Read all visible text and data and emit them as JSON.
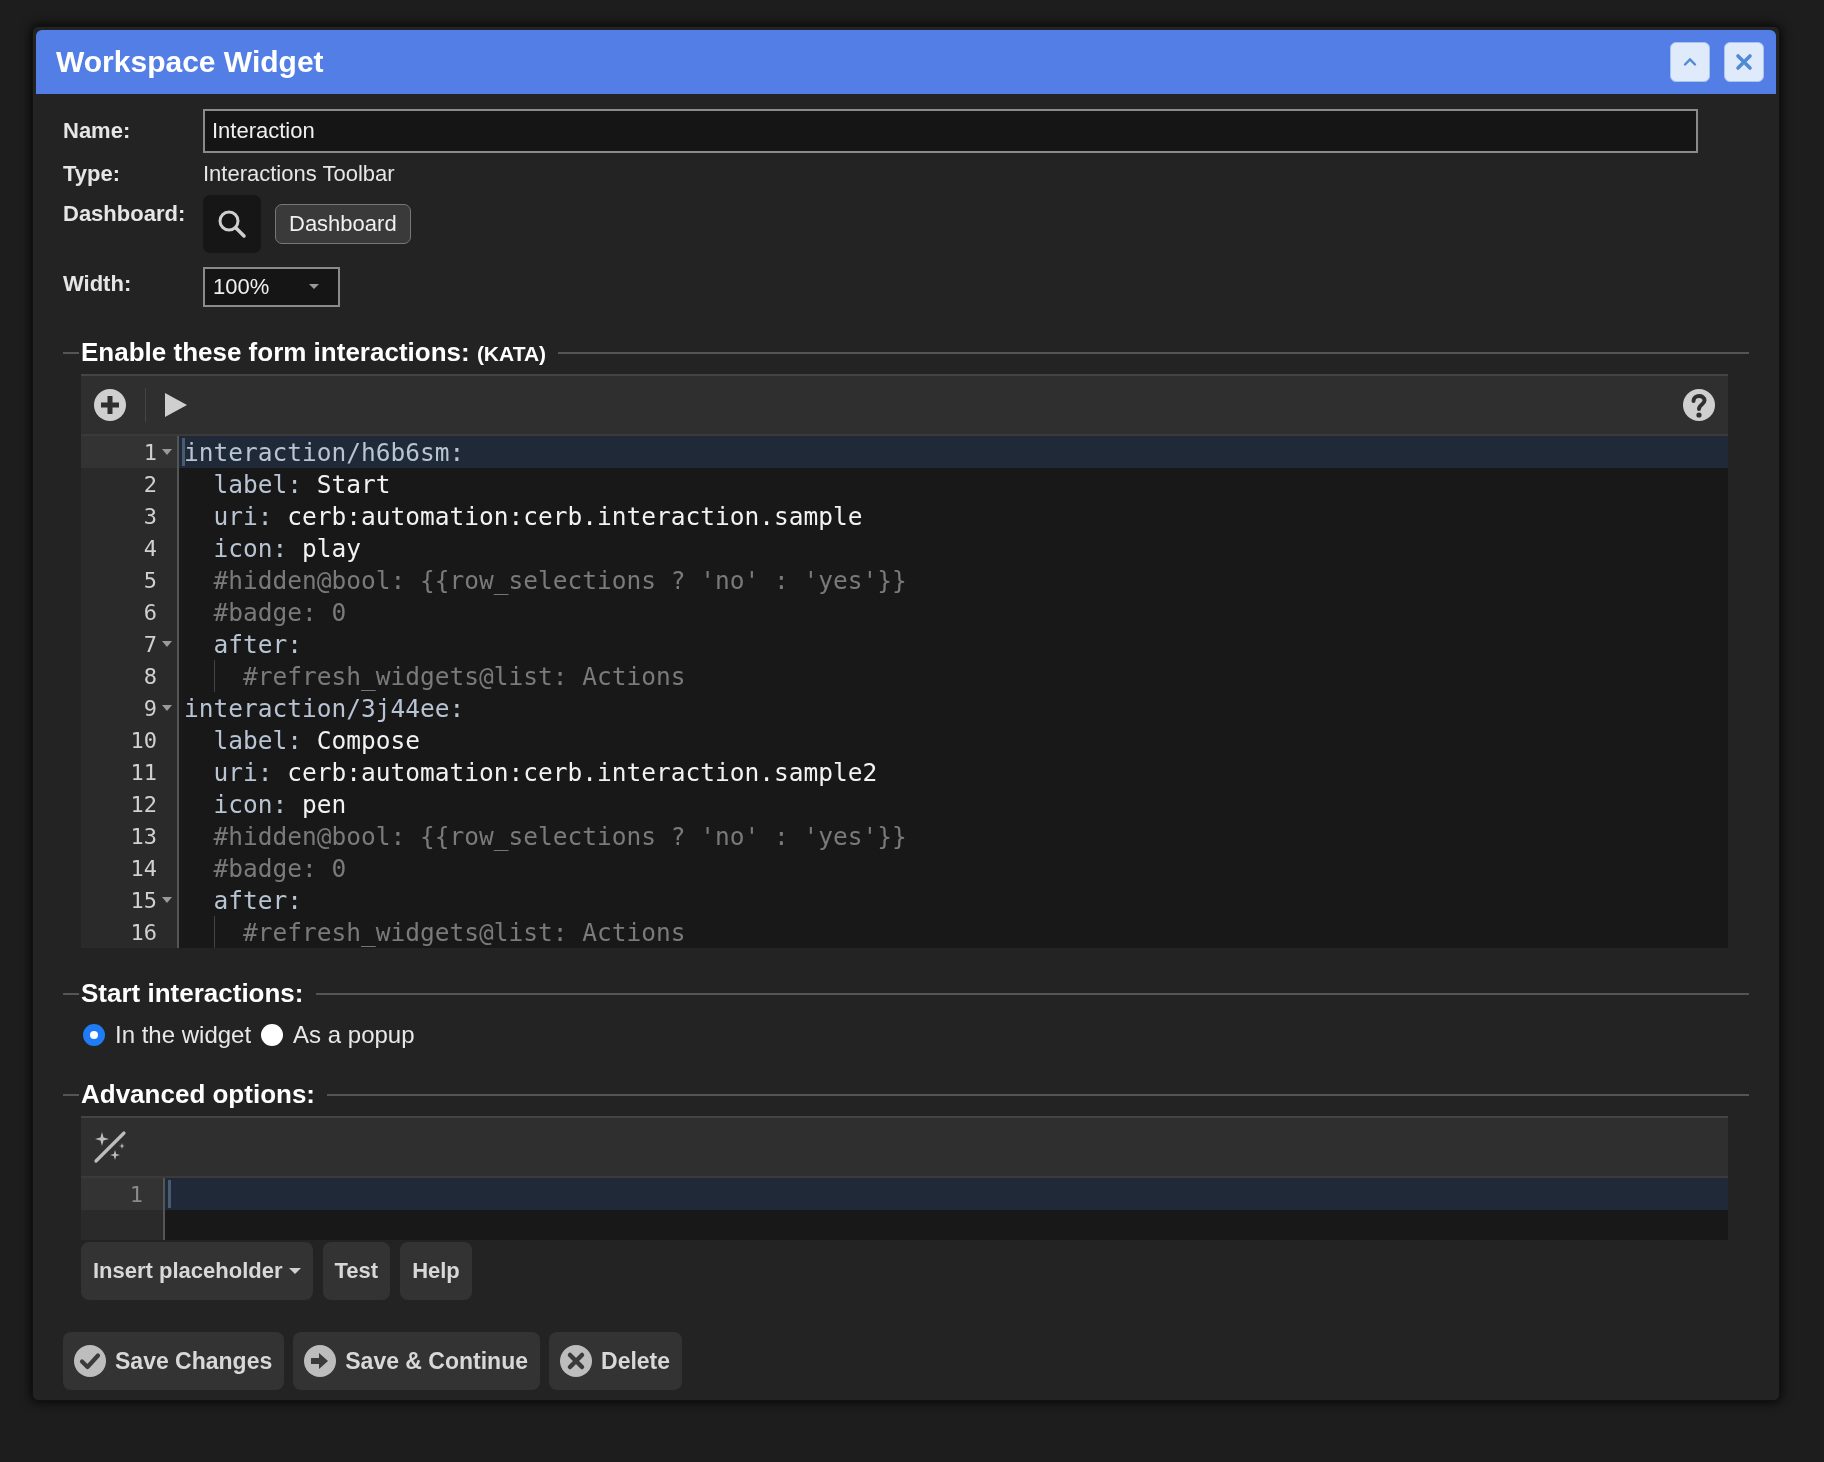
{
  "window": {
    "title": "Workspace Widget"
  },
  "form": {
    "name": {
      "label": "Name:",
      "value": "Interaction"
    },
    "type": {
      "label": "Type:",
      "value": "Interactions Toolbar"
    },
    "dashboard": {
      "label": "Dashboard:",
      "chip": "Dashboard"
    },
    "width": {
      "label": "Width:",
      "value": "100%"
    }
  },
  "interactions_section": {
    "legend": "Enable these form interactions:",
    "legend_note": "(KATA)",
    "editor": {
      "lines": [
        {
          "number": "1",
          "kind": "block",
          "fold": true,
          "active": true,
          "tokens": [
            {
              "kind": "key",
              "text": "interaction/h6b6sm:"
            }
          ]
        },
        {
          "number": "2",
          "kind": "property",
          "fold": false,
          "active": false,
          "tokens": [
            {
              "kind": "key",
              "text": "label:"
            },
            {
              "kind": "value",
              "text": "Start"
            }
          ]
        },
        {
          "number": "3",
          "kind": "property",
          "fold": false,
          "active": false,
          "tokens": [
            {
              "kind": "key",
              "text": "uri:"
            },
            {
              "kind": "value",
              "text": "cerb:automation:cerb.interaction.sample"
            }
          ]
        },
        {
          "number": "4",
          "kind": "property",
          "fold": false,
          "active": false,
          "tokens": [
            {
              "kind": "key",
              "text": "icon:"
            },
            {
              "kind": "value",
              "text": "play"
            }
          ]
        },
        {
          "number": "5",
          "kind": "property",
          "fold": false,
          "active": false,
          "tokens": [
            {
              "kind": "comment",
              "text": "#hidden@bool: {{row_selections ? 'no' : 'yes'}}"
            }
          ]
        },
        {
          "number": "6",
          "kind": "property",
          "fold": false,
          "active": false,
          "tokens": [
            {
              "kind": "comment",
              "text": "#badge: 0"
            }
          ]
        },
        {
          "number": "7",
          "kind": "property",
          "fold": true,
          "active": false,
          "tokens": [
            {
              "kind": "key",
              "text": "after:"
            }
          ]
        },
        {
          "number": "8",
          "kind": "nested",
          "fold": false,
          "active": false,
          "tokens": [
            {
              "kind": "comment",
              "text": "#refresh_widgets@list: Actions"
            }
          ]
        },
        {
          "number": "9",
          "kind": "block",
          "fold": true,
          "active": false,
          "tokens": [
            {
              "kind": "key",
              "text": "interaction/3j44ee:"
            }
          ]
        },
        {
          "number": "10",
          "kind": "property",
          "fold": false,
          "active": false,
          "tokens": [
            {
              "kind": "key",
              "text": "label:"
            },
            {
              "kind": "value",
              "text": "Compose"
            }
          ]
        },
        {
          "number": "11",
          "kind": "property",
          "fold": false,
          "active": false,
          "tokens": [
            {
              "kind": "key",
              "text": "uri:"
            },
            {
              "kind": "value",
              "text": "cerb:automation:cerb.interaction.sample2"
            }
          ]
        },
        {
          "number": "12",
          "kind": "property",
          "fold": false,
          "active": false,
          "tokens": [
            {
              "kind": "key",
              "text": "icon:"
            },
            {
              "kind": "value",
              "text": "pen"
            }
          ]
        },
        {
          "number": "13",
          "kind": "property",
          "fold": false,
          "active": false,
          "tokens": [
            {
              "kind": "comment",
              "text": "#hidden@bool: {{row_selections ? 'no' : 'yes'}}"
            }
          ]
        },
        {
          "number": "14",
          "kind": "property",
          "fold": false,
          "active": false,
          "tokens": [
            {
              "kind": "comment",
              "text": "#badge: 0"
            }
          ]
        },
        {
          "number": "15",
          "kind": "property",
          "fold": true,
          "active": false,
          "tokens": [
            {
              "kind": "key",
              "text": "after:"
            }
          ]
        },
        {
          "number": "16",
          "kind": "nested",
          "fold": false,
          "active": false,
          "tokens": [
            {
              "kind": "comment",
              "text": "#refresh_widgets@list: Actions"
            }
          ]
        }
      ]
    }
  },
  "start_section": {
    "legend": "Start interactions:",
    "options": [
      {
        "label": "In the widget",
        "selected": true
      },
      {
        "label": "As a popup",
        "selected": false
      }
    ]
  },
  "advanced_section": {
    "legend": "Advanced options:",
    "editor": {
      "lines": [
        {
          "number": "1",
          "fold": false,
          "active": true
        }
      ]
    },
    "buttons": [
      {
        "label": "Insert placeholder",
        "kind": "dropdown"
      },
      {
        "label": "Test",
        "kind": "plain"
      },
      {
        "label": "Help",
        "kind": "plain"
      }
    ]
  },
  "actions": [
    {
      "label": "Save Changes",
      "kind": "save"
    },
    {
      "label": "Save & Continue",
      "kind": "continue"
    },
    {
      "label": "Delete",
      "kind": "delete"
    }
  ]
}
